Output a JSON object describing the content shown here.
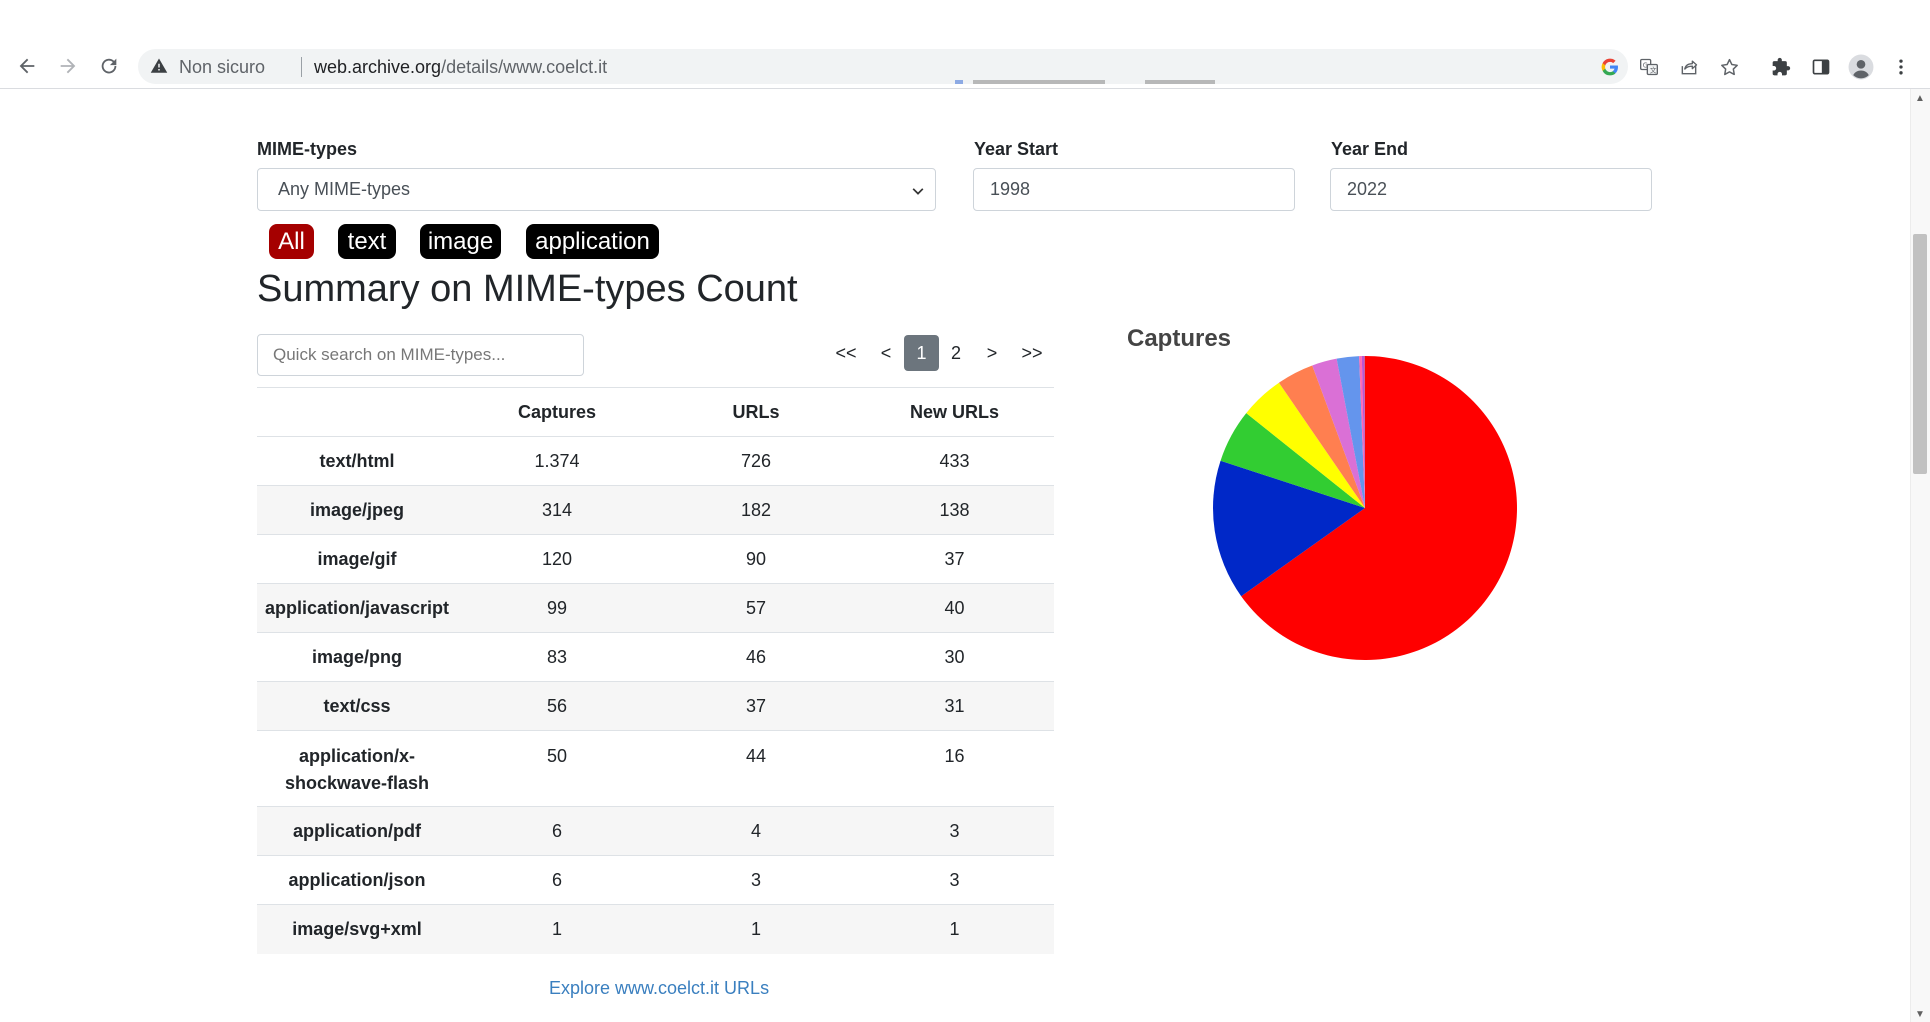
{
  "browser": {
    "not_secure": "Non sicuro",
    "url_host": "web.archive.org",
    "url_path": "/details/www.coelct.it"
  },
  "filters": {
    "mime_label": "MIME-types",
    "mime_selected": "Any MIME-types",
    "year_start_label": "Year Start",
    "year_start_value": "1998",
    "year_end_label": "Year End",
    "year_end_value": "2022"
  },
  "pills": [
    "All",
    "text",
    "image",
    "application"
  ],
  "summary_title": "Summary on MIME-types Count",
  "search_placeholder": "Quick search on MIME-types...",
  "pagination": [
    "<<",
    "<",
    "1",
    "2",
    ">",
    ">>"
  ],
  "table": {
    "headers": [
      "",
      "Captures",
      "URLs",
      "New URLs"
    ],
    "rows": [
      [
        "text/html",
        "1.374",
        "726",
        "433"
      ],
      [
        "image/jpeg",
        "314",
        "182",
        "138"
      ],
      [
        "image/gif",
        "120",
        "90",
        "37"
      ],
      [
        "application/javascript",
        "99",
        "57",
        "40"
      ],
      [
        "image/png",
        "83",
        "46",
        "30"
      ],
      [
        "text/css",
        "56",
        "37",
        "31"
      ],
      [
        "application/x-shockwave-flash",
        "50",
        "44",
        "16"
      ],
      [
        "application/pdf",
        "6",
        "4",
        "3"
      ],
      [
        "application/json",
        "6",
        "3",
        "3"
      ],
      [
        "image/svg+xml",
        "1",
        "1",
        "1"
      ]
    ]
  },
  "explore_link": "Explore www.coelct.it URLs",
  "chart_data": {
    "type": "pie",
    "title": "Captures",
    "categories": [
      "text/html",
      "image/jpeg",
      "image/gif",
      "application/javascript",
      "image/png",
      "text/css",
      "application/x-shockwave-flash",
      "application/pdf",
      "application/json",
      "image/svg+xml"
    ],
    "values": [
      1374,
      314,
      120,
      99,
      83,
      56,
      50,
      6,
      6,
      1
    ],
    "colors": [
      "#ff0000",
      "#0028c8",
      "#32cd32",
      "#ffff00",
      "#ff7f50",
      "#da70d6",
      "#6495ed",
      "#ff69b4",
      "#ba55d3",
      "#cd5c5c"
    ]
  }
}
